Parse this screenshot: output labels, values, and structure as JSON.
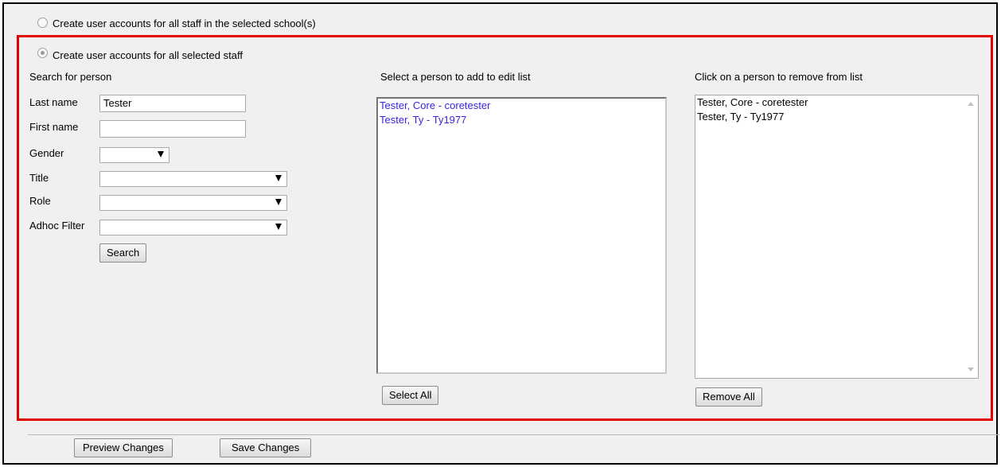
{
  "options": {
    "all_staff_school_label": "Create user accounts for all staff in the selected school(s)",
    "all_selected_staff_label": "Create user accounts for all selected staff"
  },
  "search": {
    "header": "Search for person",
    "last_name_label": "Last name",
    "last_name_value": "Tester",
    "first_name_label": "First name",
    "first_name_value": "",
    "gender_label": "Gender",
    "title_label": "Title",
    "role_label": "Role",
    "adhoc_filter_label": "Adhoc Filter",
    "search_button": "Search"
  },
  "add_list": {
    "header": "Select a person to add to edit list",
    "items": [
      "Tester, Core - coretester",
      "Tester, Ty - Ty1977"
    ],
    "select_all_button": "Select All"
  },
  "remove_list": {
    "header": "Click on a person to remove from list",
    "items": [
      "Tester, Core - coretester",
      "Tester, Ty - Ty1977"
    ],
    "remove_all_button": "Remove All"
  },
  "footer": {
    "preview_button": "Preview Changes",
    "save_button": "Save Changes"
  },
  "colors": {
    "highlight_border": "#e00000",
    "link_text": "#3a24e0",
    "panel_background": "#f0f0f0"
  }
}
